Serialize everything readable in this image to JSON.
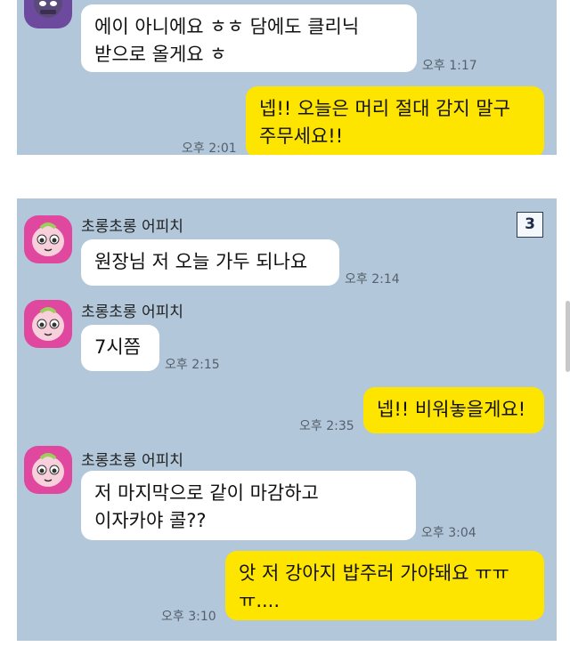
{
  "top_panel": {
    "msg_in": "에이 아니에요 ㅎㅎ 담에도 클리닉\n받으로 올게요 ㅎ",
    "msg_in_time": "오후 1:17",
    "msg_out": "넵!! 오늘은 머리 절대 감지 말구\n주무세요!!",
    "msg_out_time": "오후 2:01"
  },
  "bottom_panel": {
    "unread_count": "3",
    "sender_name": "초롱초롱 어피치",
    "messages": [
      {
        "sender": "초롱초롱 어피치",
        "text": "원장님 저 오늘 가두 되나요",
        "time": "오후 2:14"
      },
      {
        "sender": "초롱초롱 어피치",
        "text": "7시쯤",
        "time": "오후 2:15"
      },
      {
        "text": "넵!! 비워놓을게요!",
        "time": "오후 2:35"
      },
      {
        "sender": "초롱초롱 어피치",
        "text": "저 마지막으로 같이 마감하고\n이자카야 콜??",
        "time": "오후 3:04"
      },
      {
        "text": "앗 저 강아지 밥주러 가야돼요 ㅠㅠ\nㅠ....",
        "time": "오후 3:10"
      }
    ]
  },
  "colors": {
    "chat_bg": "#b2c7d9",
    "outgoing_bubble": "#fee500",
    "incoming_bubble": "#ffffff",
    "avatar_bg": "#e0479e"
  },
  "icons": {
    "apeach_avatar": "apeach-avatar-icon",
    "purple_avatar": "purple-avatar-icon"
  }
}
